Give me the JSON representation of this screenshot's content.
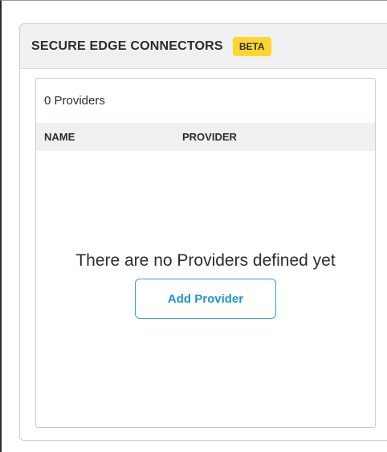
{
  "panel": {
    "title": "SECURE EDGE CONNECTORS",
    "badge": "BETA"
  },
  "providers": {
    "count_label": "0 Providers",
    "columns": [
      "NAME",
      "PROVIDER"
    ],
    "rows": [],
    "empty_message": "There are no Providers defined yet",
    "add_button_label": "Add Provider"
  },
  "colors": {
    "badge_bg": "#ffd52e",
    "accent": "#1e95cf",
    "header_bg": "#eef0f2"
  }
}
